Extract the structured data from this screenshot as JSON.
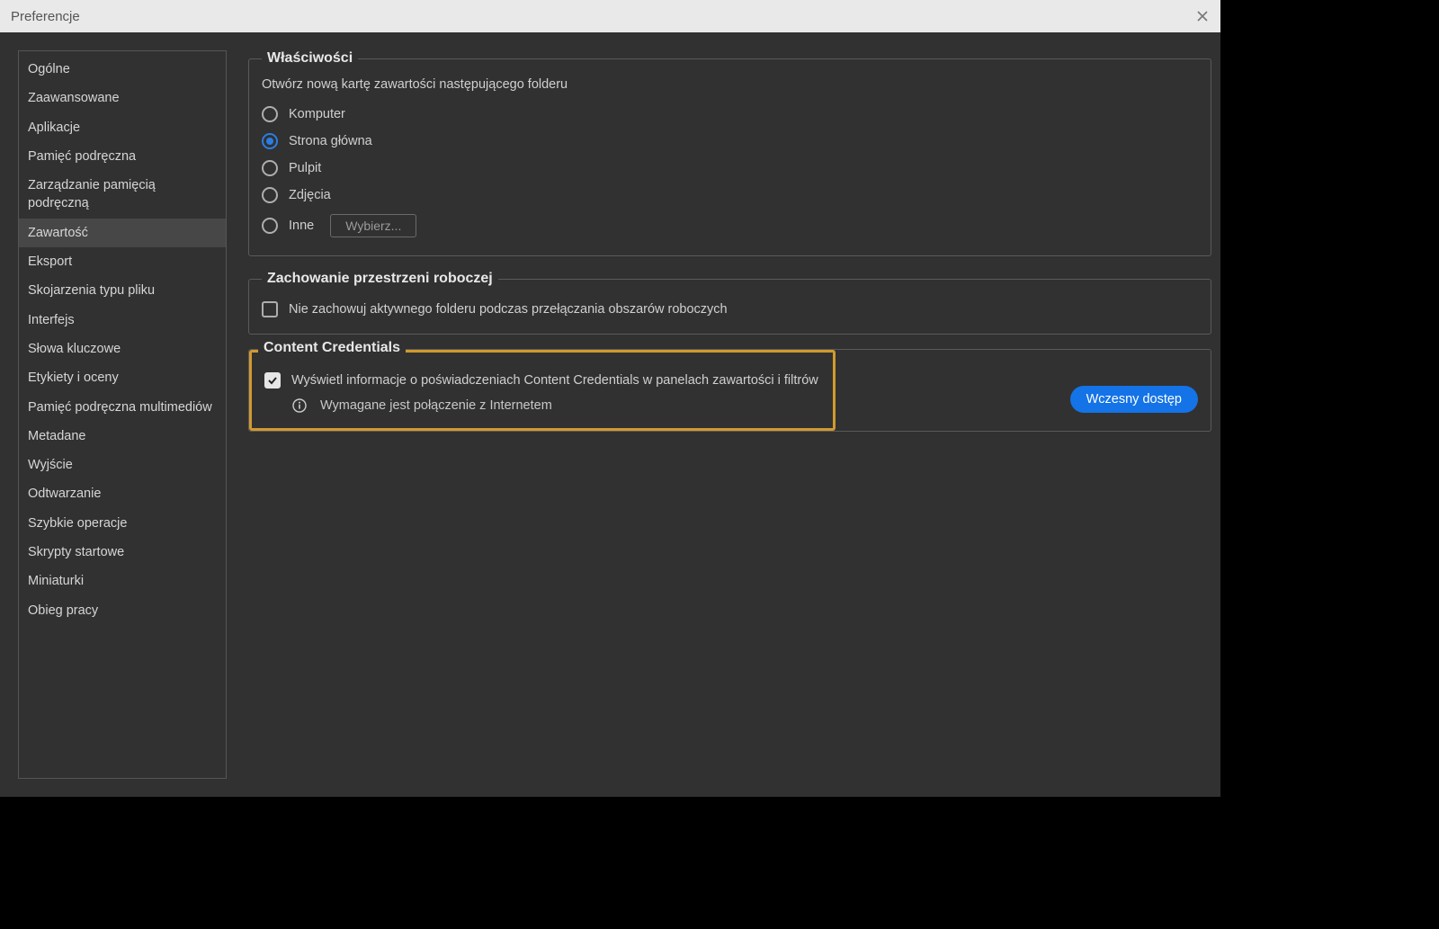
{
  "title": "Preferencje",
  "sidebar": {
    "items": [
      "Ogólne",
      "Zaawansowane",
      "Aplikacje",
      "Pamięć podręczna",
      "Zarządzanie pamięcią podręczną",
      "Zawartość",
      "Eksport",
      "Skojarzenia typu pliku",
      "Interfejs",
      "Słowa kluczowe",
      "Etykiety i oceny",
      "Pamięć podręczna multimediów",
      "Metadane",
      "Wyjście",
      "Odtwarzanie",
      "Szybkie operacje",
      "Skrypty startowe",
      "Miniaturki",
      "Obieg pracy"
    ],
    "selected_index": 5
  },
  "properties": {
    "legend": "Właściwości",
    "subtitle": "Otwórz nową kartę zawartości następującego folderu",
    "options": [
      {
        "label": "Komputer",
        "checked": false
      },
      {
        "label": "Strona główna",
        "checked": true
      },
      {
        "label": "Pulpit",
        "checked": false
      },
      {
        "label": "Zdjęcia",
        "checked": false
      },
      {
        "label": "Inne",
        "checked": false,
        "has_button": true
      }
    ],
    "choose_button": "Wybierz..."
  },
  "workspace": {
    "legend": "Zachowanie przestrzeni roboczej",
    "checkbox_label": "Nie zachowuj aktywnego folderu podczas przełączania obszarów roboczych",
    "checked": false
  },
  "content_credentials": {
    "legend": "Content Credentials",
    "checkbox_label": "Wyświetl informacje o poświadczeniach Content Credentials w panelach zawartości i filtrów",
    "checked": true,
    "info_text": "Wymagane jest połączenie z Internetem",
    "early_access": "Wczesny dostęp"
  }
}
